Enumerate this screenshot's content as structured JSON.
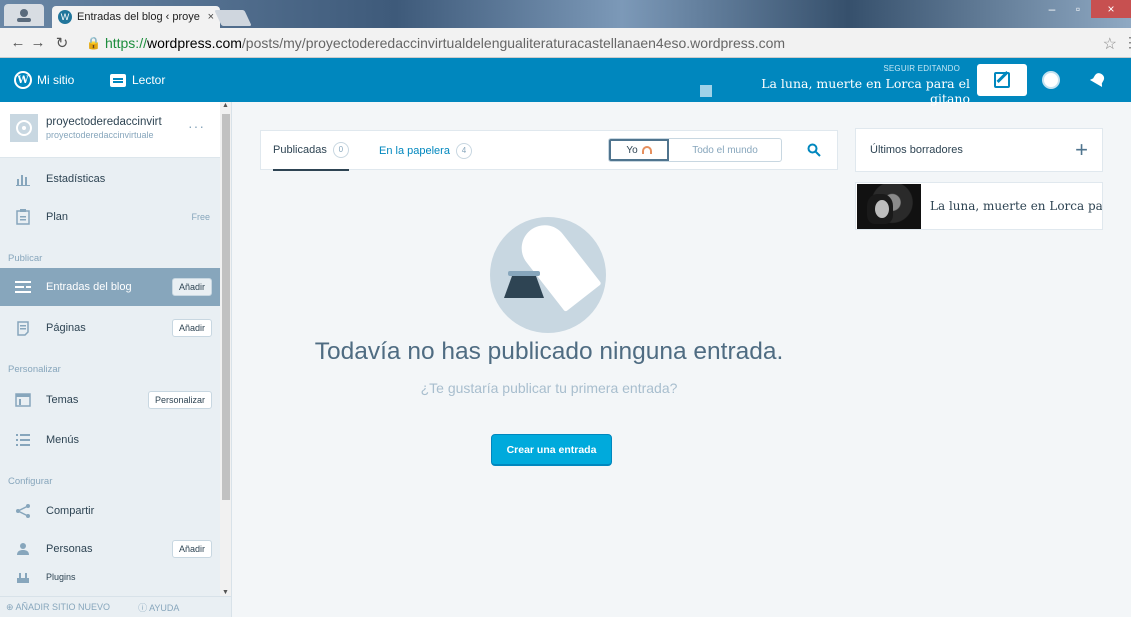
{
  "browser": {
    "tab_title": "Entradas del blog ‹ proye",
    "tab_close": "×",
    "url_scheme": "https://",
    "url_host": "wordpress.com",
    "url_path": "/posts/my/proyectoderedaccinvirtualdelengualiteraturacastellanaen4eso.wordpress.com",
    "window_controls": [
      "–",
      "▫",
      "×"
    ]
  },
  "masterbar": {
    "my_site": "Mi sitio",
    "reader": "Lector",
    "continue_label": "SEGUIR EDITANDO",
    "continue_title": "La luna, muerte en Lorca para el gitano",
    "colors": {
      "bar": "#0087be"
    }
  },
  "site": {
    "name": "proyectoderedaccinvirt",
    "domain": "proyectoderedaccinvirtuale",
    "more": "···"
  },
  "sidebar": {
    "stats": "Estadísticas",
    "plan": "Plan",
    "plan_badge": "Free",
    "heading_publish": "Publicar",
    "posts": "Entradas del blog",
    "posts_add": "Añadir",
    "pages": "Páginas",
    "pages_add": "Añadir",
    "heading_personalize": "Personalizar",
    "themes": "Temas",
    "themes_btn": "Personalizar",
    "menus": "Menús",
    "heading_configure": "Configurar",
    "sharing": "Compartir",
    "people": "Personas",
    "people_add": "Añadir",
    "plugins": "Plugins",
    "footer_add_site": "AÑADIR SITIO NUEVO",
    "footer_help": "AYUDA"
  },
  "posts_nav": {
    "tab_published": "Publicadas",
    "tab_published_count": "0",
    "tab_trash": "En la papelera",
    "tab_trash_count": "4",
    "filter_me": "Yo",
    "filter_everyone": "Todo el mundo"
  },
  "empty_state": {
    "title": "Todavía no has publicado ninguna entrada.",
    "subtitle": "¿Te gustaría publicar tu primera entrada?",
    "cta": "Crear una entrada"
  },
  "drafts": {
    "heading": "Últimos borradores",
    "items": [
      {
        "title": "La luna, muerte en Lorca para el gitano"
      }
    ]
  }
}
